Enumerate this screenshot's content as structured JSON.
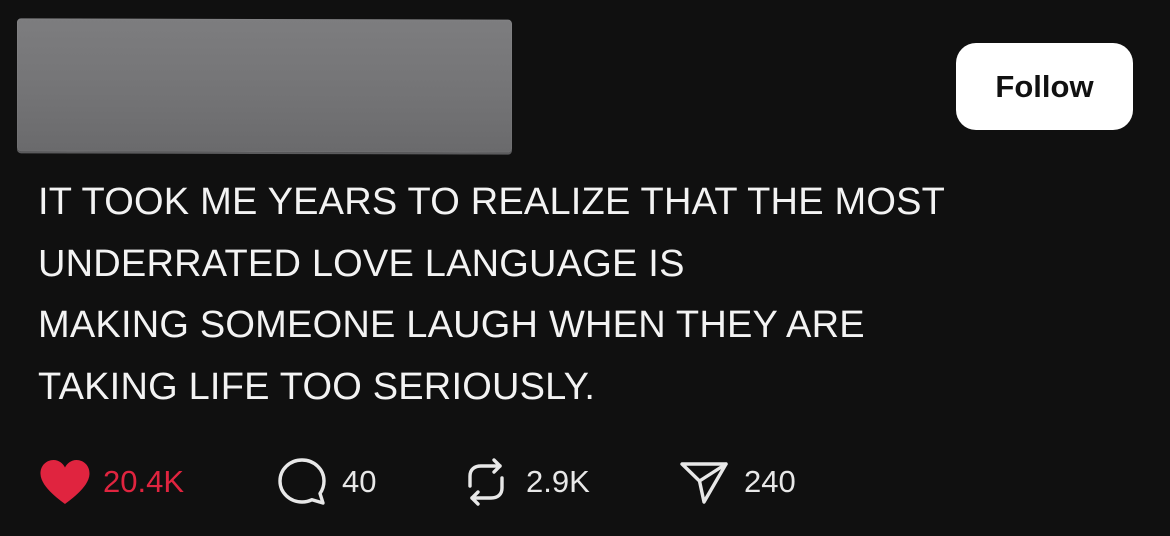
{
  "header": {
    "follow_label": "Follow"
  },
  "post": {
    "lines": [
      "IT TOOK ME YEARS TO REALIZE THAT THE MOST",
      "UNDERRATED LOVE LANGUAGE IS",
      "MAKING SOMEONE LAUGH WHEN THEY ARE",
      "TAKING LIFE TOO SERIOUSLY."
    ]
  },
  "actions": {
    "likes": "20.4K",
    "comments": "40",
    "reposts": "2.9K",
    "shares": "240",
    "liked": true
  },
  "colors": {
    "background": "#101010",
    "like_red": "#e0243f",
    "text": "#f3f3f3",
    "follow_bg": "#ffffff"
  },
  "icons": [
    "heart-icon",
    "comment-icon",
    "repost-icon",
    "share-icon"
  ]
}
